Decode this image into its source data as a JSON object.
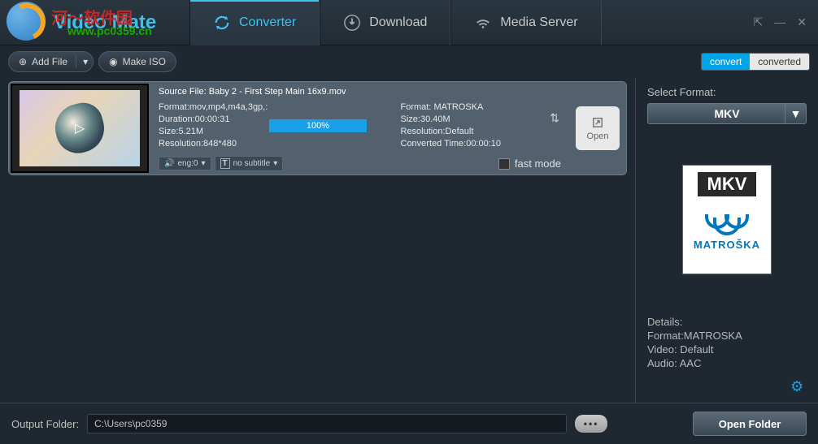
{
  "app": {
    "title": "Video Mate",
    "watermark_text1": "河～软件园",
    "watermark_text2": "www.pc0359.cn"
  },
  "nav": {
    "converter": "Converter",
    "download": "Download",
    "media_server": "Media Server"
  },
  "toolbar": {
    "add_file": "Add File",
    "make_iso": "Make ISO",
    "convert": "convert",
    "converted": "converted"
  },
  "file": {
    "source": "Source File: Baby 2 - First Step Main 16x9.mov",
    "left": {
      "format": "Format:mov,mp4,m4a,3gp,:",
      "duration": "Duration:00:00:31",
      "size": "Size:5.21M",
      "resolution": "Resolution:848*480"
    },
    "right": {
      "format": "Format: MATROSKA",
      "size": "Size:30.40M",
      "resolution": "Resolution:Default",
      "converted_time": "Converted Time:00:00:10"
    },
    "progress": "100%",
    "progress_pct": 100,
    "audio_lang": "eng:0",
    "subtitle": "no subtitle",
    "fast_mode": "fast mode",
    "open": "Open"
  },
  "format_panel": {
    "select_label": "Select Format:",
    "selected": "MKV",
    "icon_top": "MKV",
    "icon_bottom": "MATROŠKA",
    "details_label": "Details:",
    "details_format": "Format:MATROSKA",
    "details_video": "Video: Default",
    "details_audio": "Audio: AAC"
  },
  "footer": {
    "label": "Output Folder:",
    "path": "C:\\Users\\pc0359",
    "browse": "•••",
    "open_folder": "Open Folder"
  }
}
